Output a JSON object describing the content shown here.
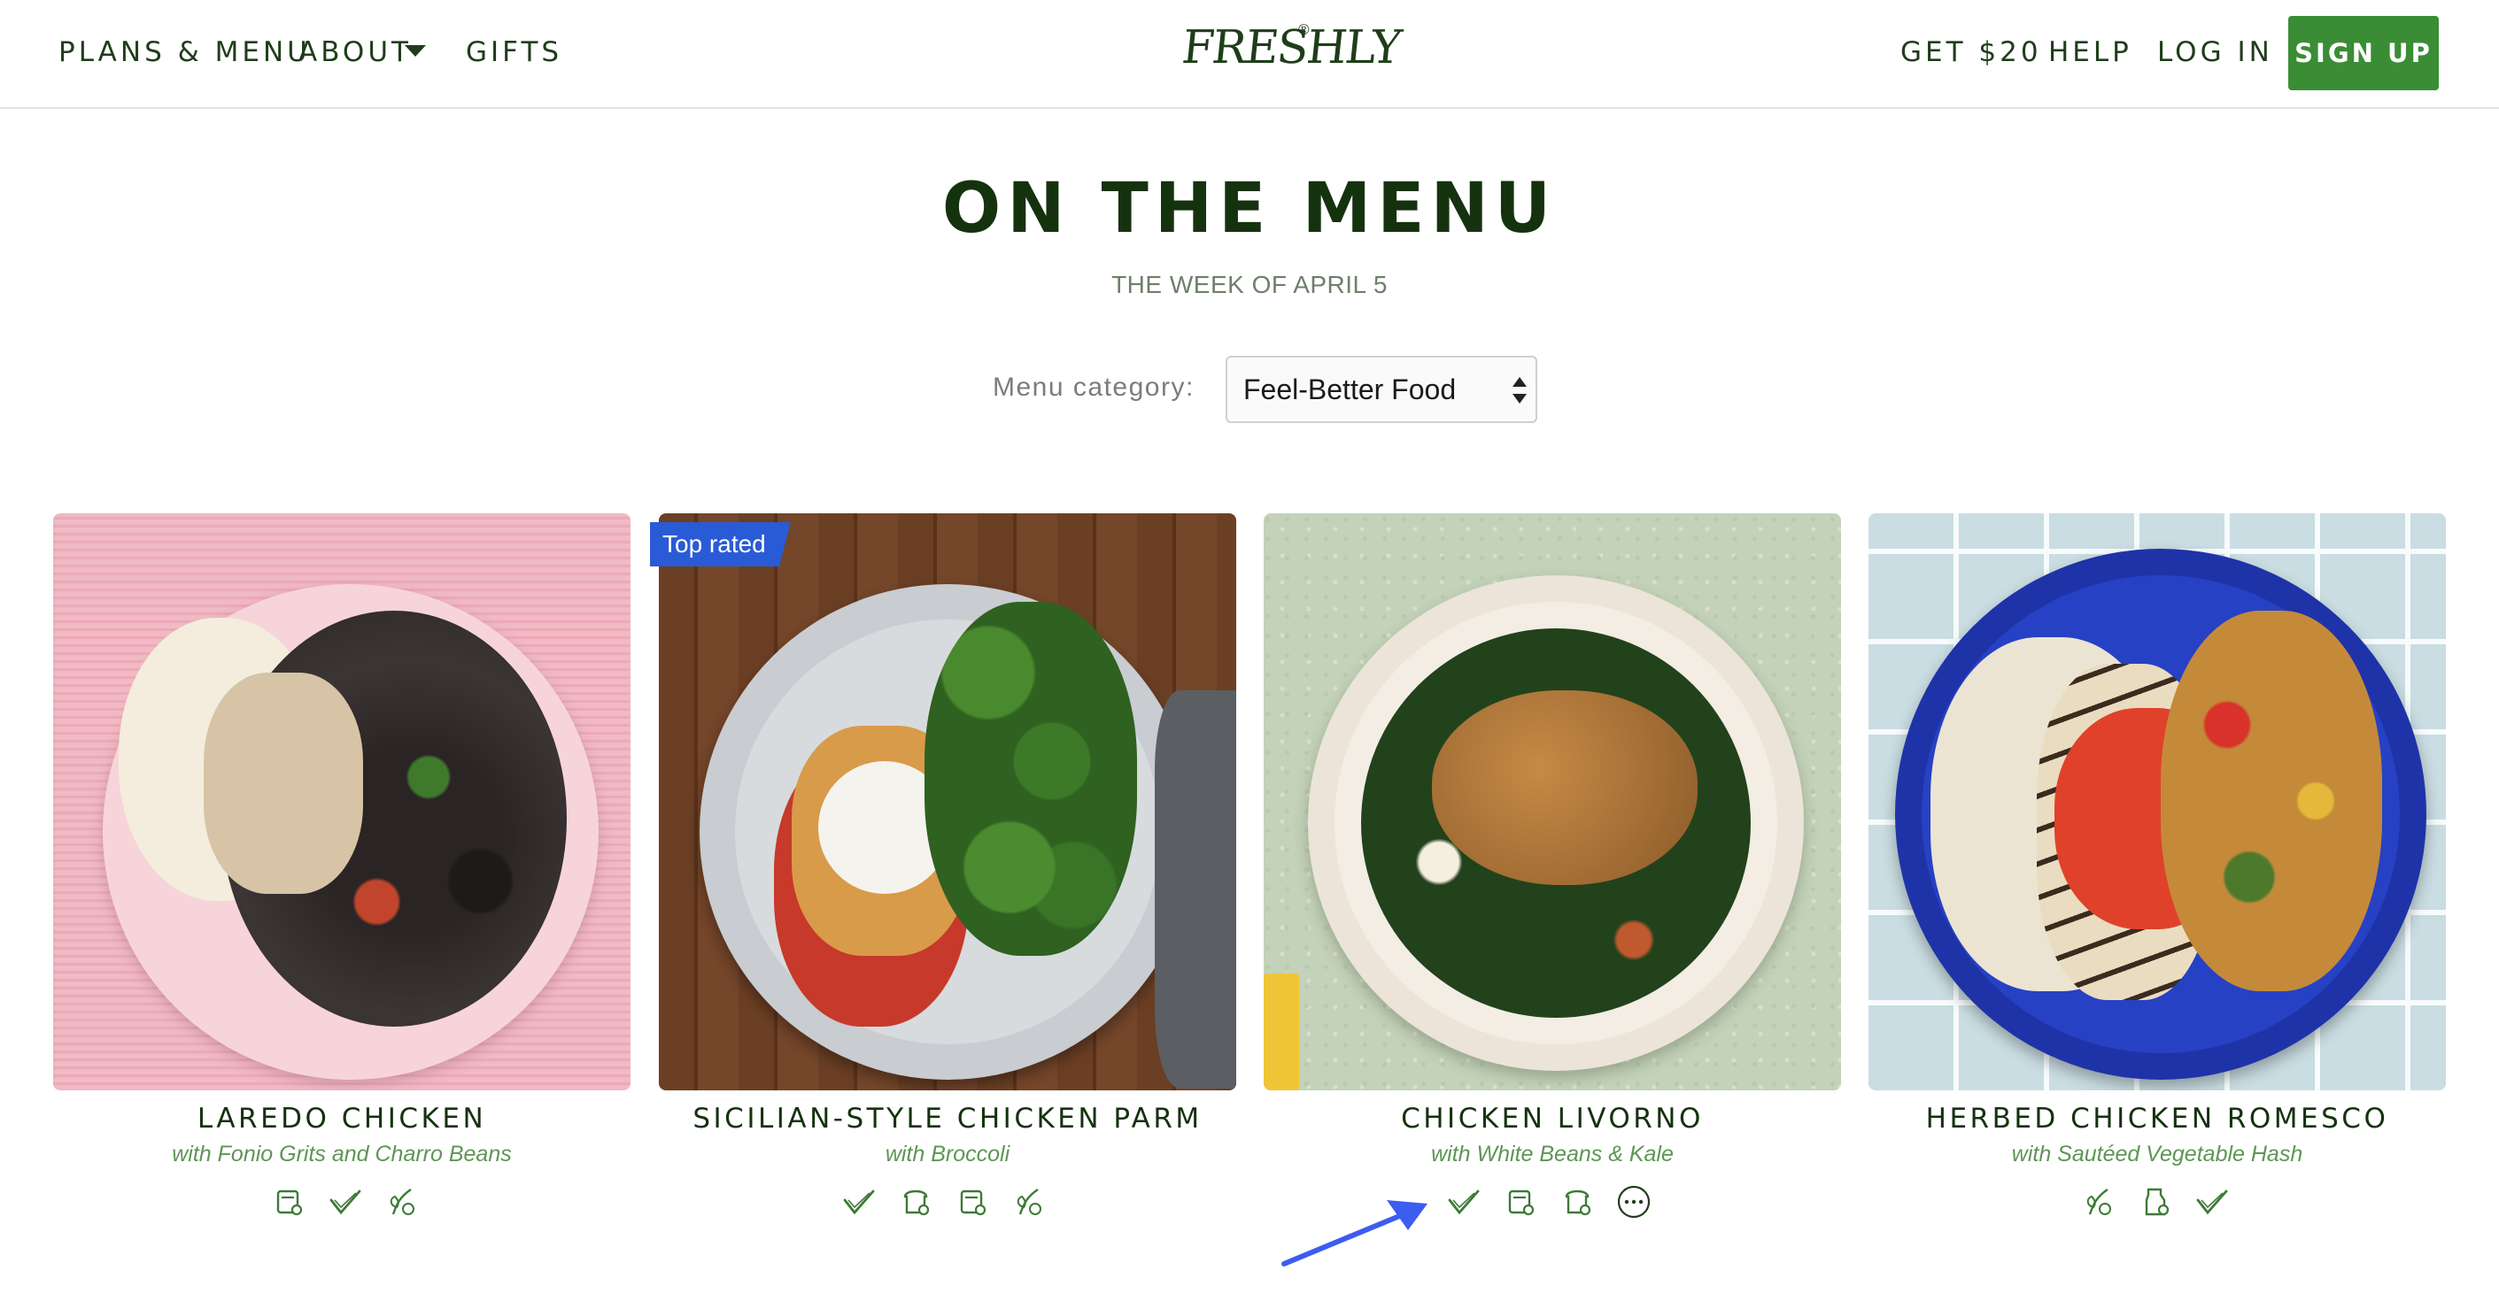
{
  "nav": {
    "plans_menu": "PLANS & MENU",
    "about": "ABOUT",
    "gifts": "GIFTS",
    "logo": "FRESHLY",
    "logo_mark": "®",
    "get20": "GET $20",
    "help": "HELP",
    "login": "LOG IN",
    "signup": "SIGN UP"
  },
  "hero": {
    "title": "ON THE MENU",
    "week": "THE WEEK OF APRIL 5",
    "category_label": "Menu category:",
    "category_value": "Feel-Better Food"
  },
  "dishes": [
    {
      "name": "LAREDO CHICKEN",
      "subtitle": "with Fonio Grits and Charro Beans",
      "badge": "",
      "icons": [
        "container-icon",
        "checkmark-leaf-icon",
        "sprout-icon"
      ]
    },
    {
      "name": "SICILIAN-STYLE CHICKEN PARM",
      "subtitle": "with Broccoli",
      "badge": "Top rated",
      "icons": [
        "checkmark-leaf-icon",
        "bread-icon",
        "container-icon",
        "sprout-icon"
      ]
    },
    {
      "name": "CHICKEN LIVORNO",
      "subtitle": "with White Beans & Kale",
      "badge": "",
      "icons": [
        "checkmark-leaf-icon",
        "container-icon",
        "bread-icon",
        "more-icon"
      ]
    },
    {
      "name": "HERBED CHICKEN ROMESCO",
      "subtitle": "with Sautéed Vegetable Hash",
      "badge": "",
      "icons": [
        "sprout-icon",
        "milk-carton-icon",
        "checkmark-leaf-icon"
      ]
    }
  ],
  "colors": {
    "brand_green": "#3a8d35",
    "dark_green": "#15320f",
    "subtitle_green": "#5d9654",
    "badge_blue": "#2a5bd6",
    "annotation_arrow": "#3d5cf0"
  }
}
